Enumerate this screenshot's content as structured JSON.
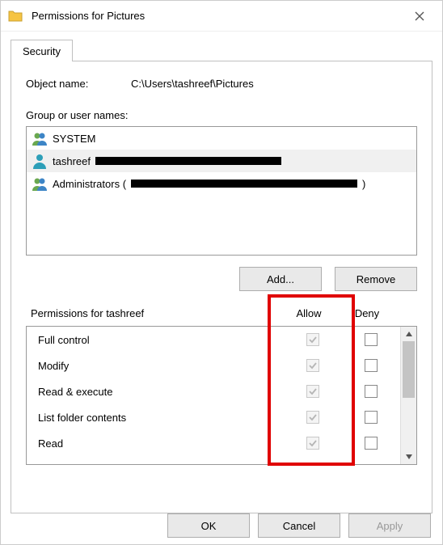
{
  "window": {
    "title": "Permissions for Pictures"
  },
  "tab": {
    "security_label": "Security"
  },
  "object": {
    "label": "Object name:",
    "value": "C:\\Users\\tashreef\\Pictures"
  },
  "groups": {
    "label": "Group or user names:",
    "items": [
      {
        "name": "SYSTEM",
        "icon": "group",
        "redact_width": 0,
        "selected": false
      },
      {
        "name": "tashreef",
        "icon": "user",
        "redact_width": 230,
        "selected": true
      },
      {
        "name": "Administrators (",
        "icon": "group",
        "redact_width": 280,
        "suffix": ")",
        "selected": false
      }
    ]
  },
  "buttons": {
    "add": "Add...",
    "remove": "Remove",
    "ok": "OK",
    "cancel": "Cancel",
    "apply": "Apply"
  },
  "perm": {
    "title": "Permissions for tashreef",
    "col_allow": "Allow",
    "col_deny": "Deny",
    "rows": [
      {
        "name": "Full control",
        "allow": true,
        "deny": false,
        "enabled": false
      },
      {
        "name": "Modify",
        "allow": true,
        "deny": false,
        "enabled": false
      },
      {
        "name": "Read & execute",
        "allow": true,
        "deny": false,
        "enabled": false
      },
      {
        "name": "List folder contents",
        "allow": true,
        "deny": false,
        "enabled": false
      },
      {
        "name": "Read",
        "allow": true,
        "deny": false,
        "enabled": false
      }
    ]
  }
}
